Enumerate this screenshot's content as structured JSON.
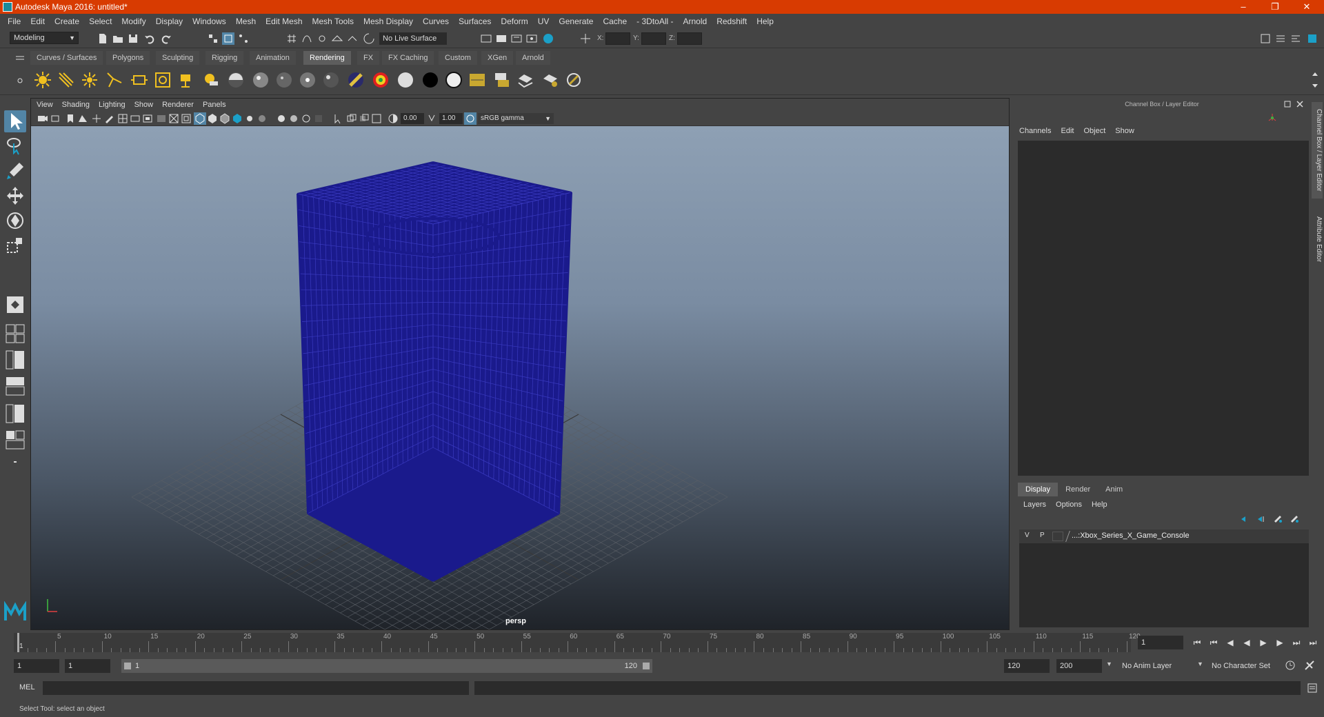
{
  "titlebar": {
    "title": "Autodesk Maya 2016: untitled*"
  },
  "menubar": {
    "items": [
      "File",
      "Edit",
      "Create",
      "Select",
      "Modify",
      "Display",
      "Windows",
      "Mesh",
      "Edit Mesh",
      "Mesh Tools",
      "Mesh Display",
      "Curves",
      "Surfaces",
      "Deform",
      "UV",
      "Generate",
      "Cache",
      "- 3DtoAll -",
      "Arnold",
      "Redshift",
      "Help"
    ]
  },
  "statusline": {
    "mode": "Modeling",
    "live_surface": "No Live Surface",
    "x_label": "X:",
    "y_label": "Y:",
    "z_label": "Z:"
  },
  "shelf": {
    "tabs": [
      "Curves / Surfaces",
      "Polygons",
      "Sculpting",
      "Rigging",
      "Animation",
      "Rendering",
      "FX",
      "FX Caching",
      "Custom",
      "XGen",
      "Arnold"
    ],
    "active_tab": "Rendering"
  },
  "viewport": {
    "menu": [
      "View",
      "Shading",
      "Lighting",
      "Show",
      "Renderer",
      "Panels"
    ],
    "exposure": "0.00",
    "gamma": "1.00",
    "color_space": "sRGB gamma",
    "camera": "persp",
    "wire_color": "#1a1a8c"
  },
  "right_panel": {
    "title": "Channel Box / Layer Editor",
    "channel_menu": [
      "Channels",
      "Edit",
      "Object",
      "Show"
    ],
    "layer_tabs": [
      "Display",
      "Render",
      "Anim"
    ],
    "active_layer_tab": "Display",
    "layer_menu": [
      "Layers",
      "Options",
      "Help"
    ],
    "layer": {
      "v": "V",
      "p": "P",
      "name": "...:Xbox_Series_X_Game_Console"
    },
    "side_tabs": [
      "Channel Box / Layer Editor",
      "Attribute Editor"
    ]
  },
  "timeline": {
    "ticks": [
      "5",
      "10",
      "15",
      "20",
      "25",
      "30",
      "35",
      "40",
      "45",
      "50",
      "55",
      "60",
      "65",
      "70",
      "75",
      "80",
      "85",
      "90",
      "95",
      "100",
      "105",
      "110",
      "115",
      "120"
    ],
    "first_frame": "1",
    "current_frame": "1"
  },
  "range": {
    "start": "1",
    "playback_start": "1",
    "slider_start": "1",
    "slider_end": "120",
    "playback_end": "120",
    "end": "200",
    "anim_layer": "No Anim Layer",
    "character_set": "No Character Set"
  },
  "cmdline": {
    "label": "MEL"
  },
  "helpline": {
    "text": "Select Tool: select an object"
  }
}
